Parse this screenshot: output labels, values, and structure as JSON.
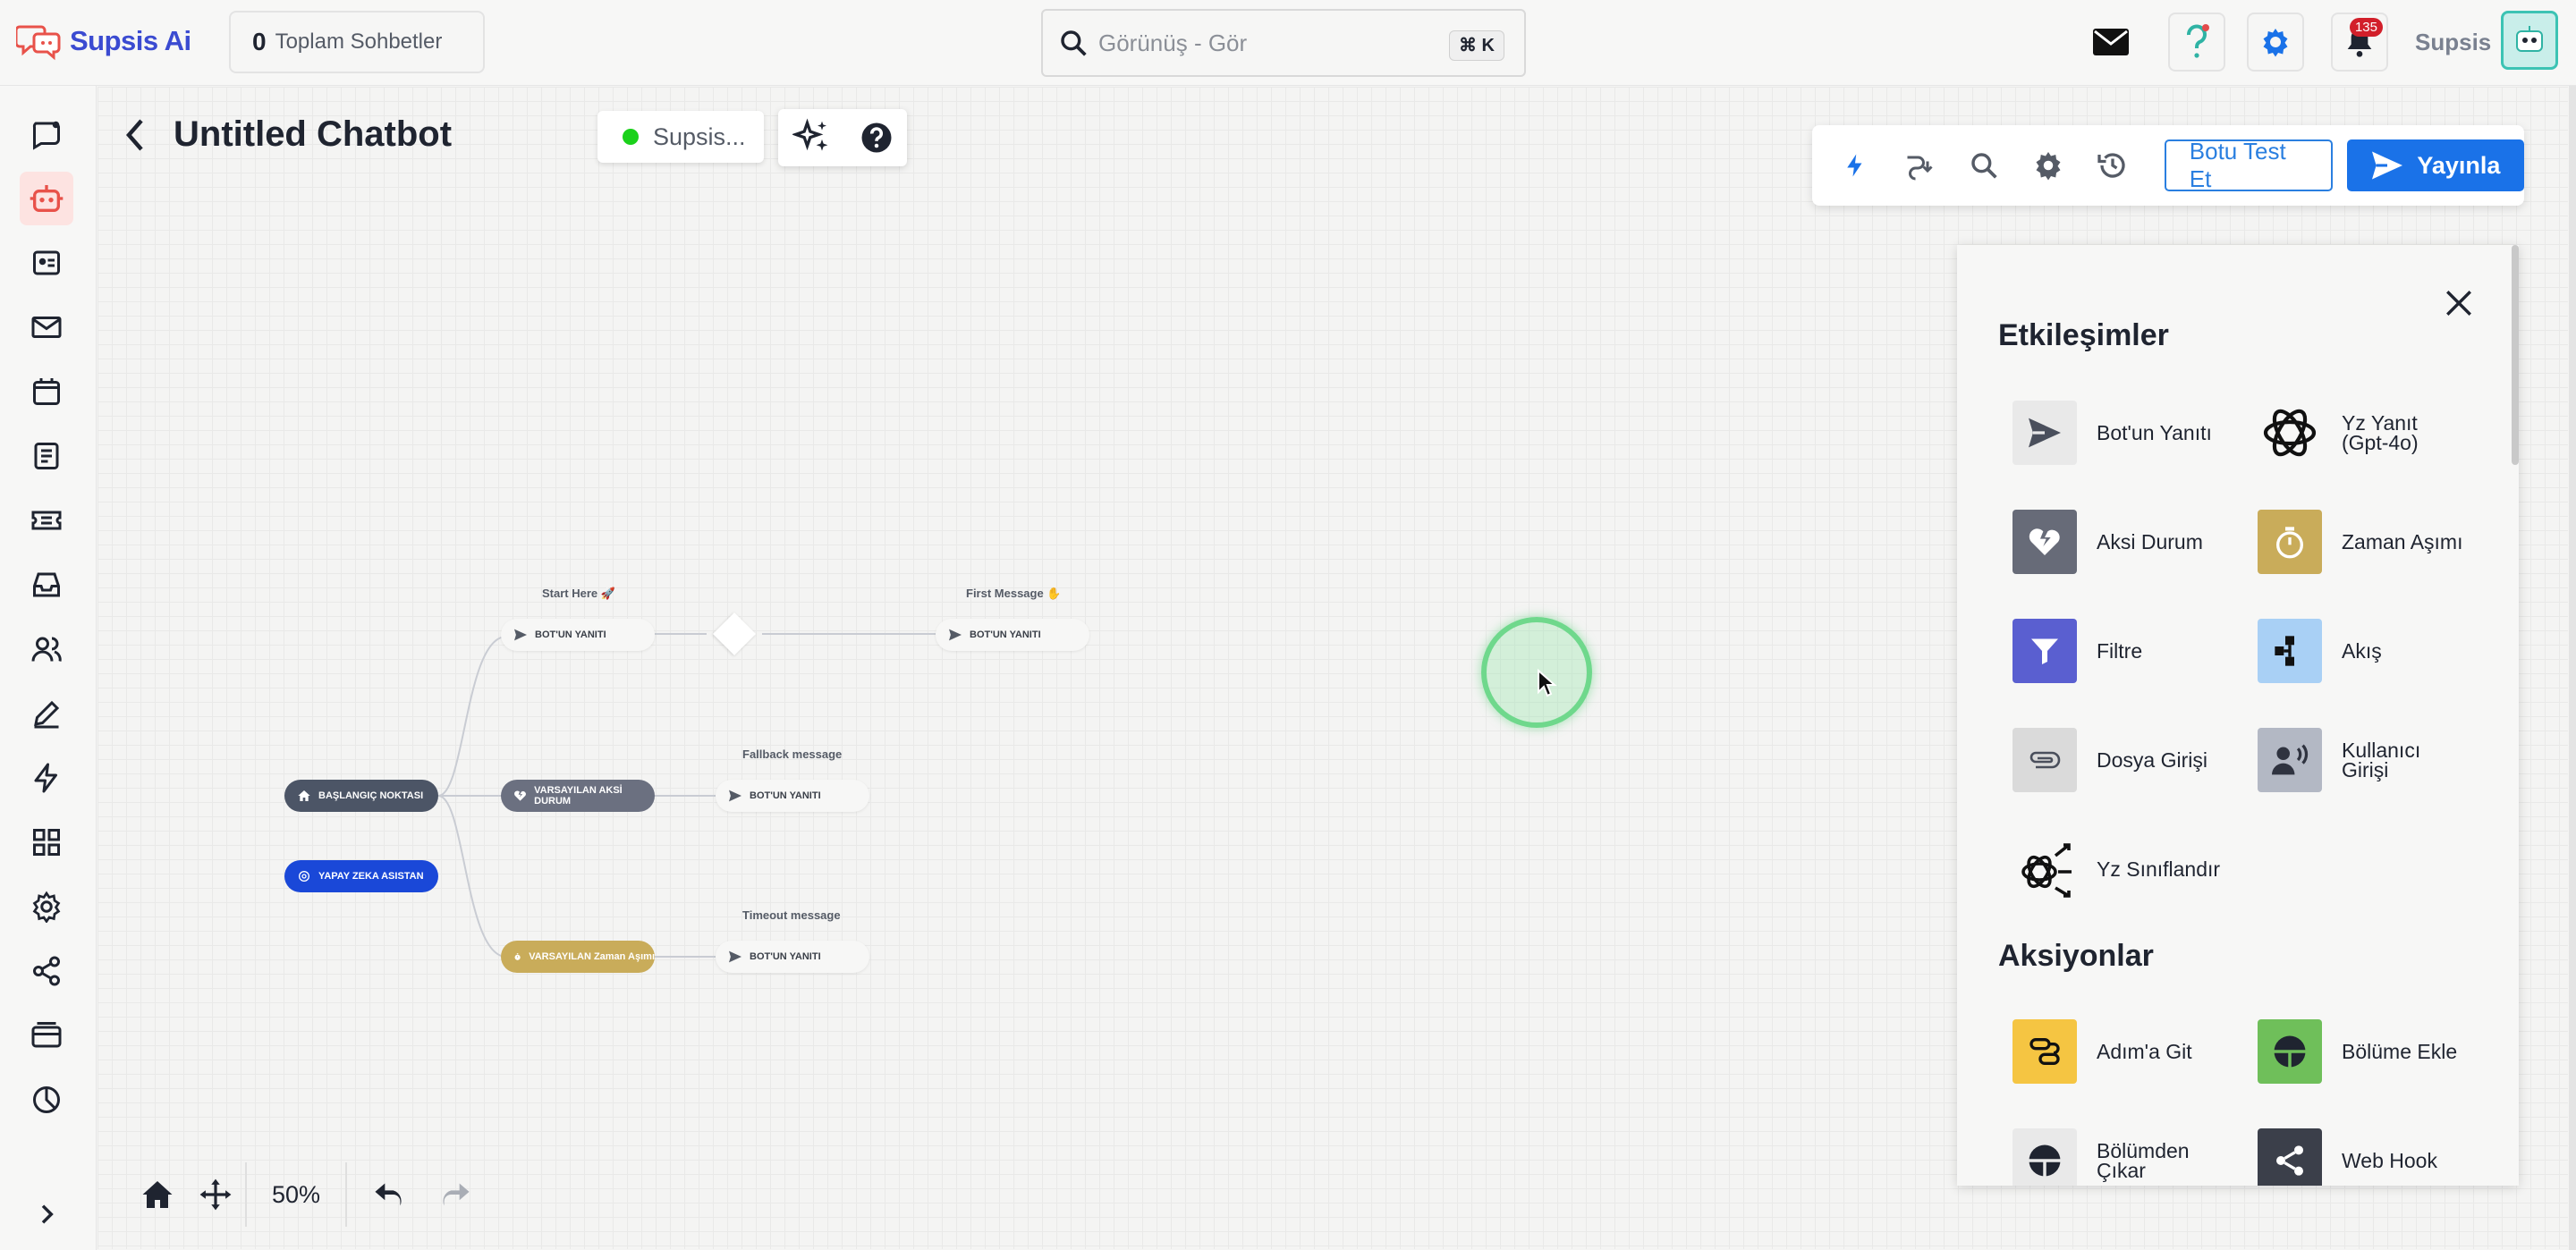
{
  "brand": {
    "name": "Supsis Ai"
  },
  "header": {
    "conversations_count": "0",
    "conversations_label": "Toplam Sohbetler",
    "search_value": "Görünüş - Gör",
    "search_shortcut": "⌘ K",
    "notification_count": "135",
    "user_name": "Supsis"
  },
  "canvas": {
    "title": "Untitled Chatbot",
    "status_label": "Supsis...",
    "zoom": "50%"
  },
  "toolbar": {
    "test_label": "Botu Test Et",
    "publish_label": "Yayınla"
  },
  "flow": {
    "start_here": "Start Here 🚀",
    "first_message": "First Message ✋",
    "fallback_message": "Fallback message",
    "timeout_message": "Timeout message",
    "start_node": "BAŞLANGIÇ NOKTASI",
    "ai_assistant": "YAPAY ZEKA ASISTAN",
    "bot_reply": "BOT'UN YANITI",
    "default_fallback": "VARSAYILAN AKSİ DURUM",
    "default_timeout": "VARSAYILAN Zaman Aşımı"
  },
  "panel": {
    "interactions_title": "Etkileşimler",
    "actions_title": "Aksiyonlar",
    "interactions": [
      {
        "label": "Bot'un Yanıtı",
        "icon": "send-icon",
        "color": "#e9e9e9"
      },
      {
        "label": "Yz Yanıt (Gpt-4o)",
        "icon": "openai-icon",
        "color": "#f7f7f6"
      },
      {
        "label": "Aksi Durum",
        "icon": "broken-heart-icon",
        "color": "#676b78"
      },
      {
        "label": "Zaman Aşımı",
        "icon": "stopwatch-icon",
        "color": "#c9ac5a"
      },
      {
        "label": "Filtre",
        "icon": "filter-icon",
        "color": "#5a5fd0"
      },
      {
        "label": "Akış",
        "icon": "flow-icon",
        "color": "#a9d0f5"
      },
      {
        "label": "Dosya Girişi",
        "icon": "paperclip-icon",
        "color": "#dadada"
      },
      {
        "label": "Kullanıcı Girişi",
        "icon": "user-voice-icon",
        "color": "#b3b8c4"
      },
      {
        "label": "Yz Sınıflandır",
        "icon": "ai-classify-icon",
        "color": "#f7f7f6"
      }
    ],
    "actions": [
      {
        "label": "Adım'a Git",
        "icon": "goto-step-icon",
        "color": "#f5c542"
      },
      {
        "label": "Bölüme Ekle",
        "icon": "segment-add-icon",
        "color": "#6fbf5a"
      },
      {
        "label": "Bölümden Çıkar",
        "icon": "segment-remove-icon",
        "color": "#e9e9e9"
      },
      {
        "label": "Web Hook",
        "icon": "share-icon",
        "color": "#3b3f4a"
      }
    ]
  }
}
